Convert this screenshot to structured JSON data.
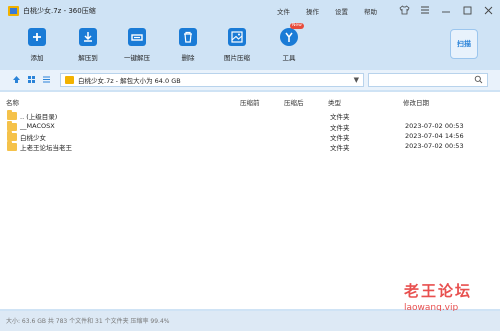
{
  "window": {
    "title": "白桃少女.7z - 360压缩",
    "menu": [
      "文件",
      "操作",
      "设置",
      "帮助"
    ],
    "controls": [
      "shirt-icon",
      "menu-icon",
      "minimize-icon",
      "maximize-icon",
      "close-icon"
    ]
  },
  "toolbar": {
    "buttons": [
      {
        "label": "添加",
        "icon": "add-icon"
      },
      {
        "label": "解压到",
        "icon": "extract-to-icon"
      },
      {
        "label": "一键解压",
        "icon": "one-click-extract-icon"
      },
      {
        "label": "删除",
        "icon": "delete-icon"
      },
      {
        "label": "图片压缩",
        "icon": "image-compress-icon"
      },
      {
        "label": "工具",
        "icon": "tools-icon",
        "badge": "New"
      }
    ],
    "scan_label": "扫描"
  },
  "addressbar": {
    "path": "白桃少女.7z - 解包大小为 64.0 GB"
  },
  "columns": [
    "名称",
    "压缩前",
    "压缩后",
    "类型",
    "修改日期"
  ],
  "files": [
    {
      "name": ".. (上级目录)",
      "type": "文件夹",
      "date": ""
    },
    {
      "name": "__MACOSX",
      "type": "文件夹",
      "date": "2023-07-02 00:53"
    },
    {
      "name": "白桃少女",
      "type": "文件夹",
      "date": "2023-07-04 14:56"
    },
    {
      "name": "上老王论坛当老王",
      "type": "文件夹",
      "date": "2023-07-02 00:53"
    }
  ],
  "watermark": {
    "line1": "老王论坛",
    "line2": "laowang.vip"
  },
  "status": "大小: 63.6 GB 共 783 个文件和 31 个文件夹 压缩率 99.4%",
  "colors": {
    "accent": "#1a7bd6",
    "folder": "#f5c24a",
    "watermark": "#e8504f",
    "chrome": "#cfe3f5"
  }
}
